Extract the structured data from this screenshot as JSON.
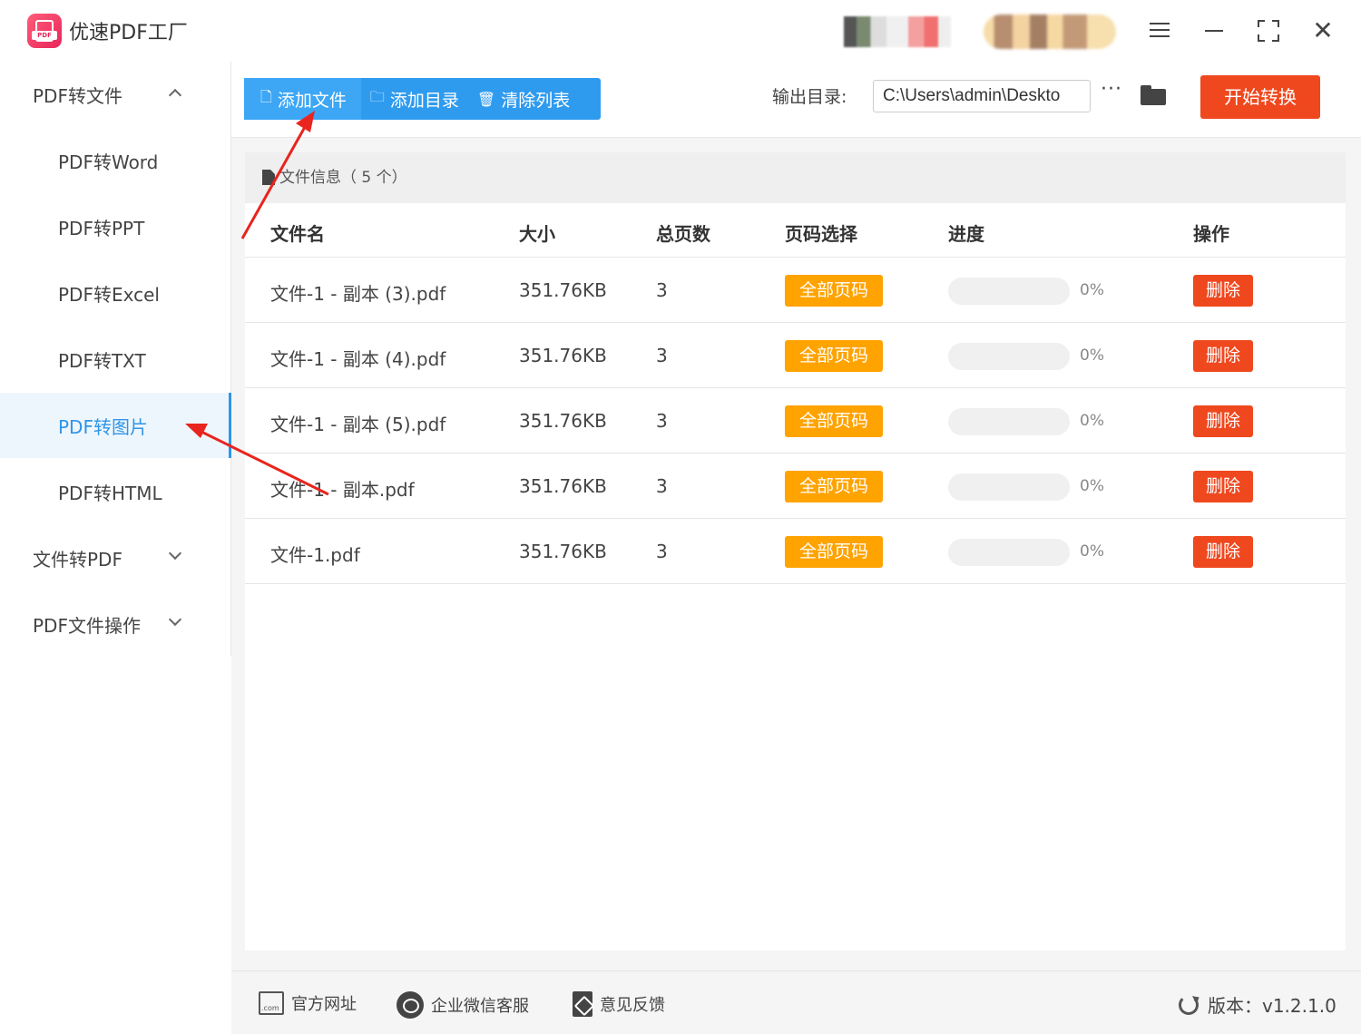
{
  "app": {
    "title": "优速PDF工厂",
    "logo_text": "PDF"
  },
  "sidebar": {
    "groups": [
      {
        "label": "PDF转文件",
        "expanded": true
      },
      {
        "label": "文件转PDF",
        "expanded": false
      },
      {
        "label": "PDF文件操作",
        "expanded": false
      }
    ],
    "items": [
      {
        "label": "PDF转Word"
      },
      {
        "label": "PDF转PPT"
      },
      {
        "label": "PDF转Excel"
      },
      {
        "label": "PDF转TXT"
      },
      {
        "label": "PDF转图片",
        "active": true
      },
      {
        "label": "PDF转HTML"
      }
    ]
  },
  "toolbar": {
    "add_file": "添加文件",
    "add_folder": "添加目录",
    "clear_list": "清除列表",
    "output_label": "输出目录:",
    "output_path": "C:\\Users\\admin\\Deskto",
    "more": "···",
    "start": "开始转换"
  },
  "panel": {
    "header": "文件信息（ 5 个）",
    "columns": {
      "name": "文件名",
      "size": "大小",
      "pages": "总页数",
      "page_select": "页码选择",
      "progress": "进度",
      "action": "操作"
    },
    "rows": [
      {
        "name": "文件-1 - 副本 (3).pdf",
        "size": "351.76KB",
        "pages": "3",
        "page_select": "全部页码",
        "progress_pct": 0,
        "progress": "0%",
        "action": "删除"
      },
      {
        "name": "文件-1 - 副本 (4).pdf",
        "size": "351.76KB",
        "pages": "3",
        "page_select": "全部页码",
        "progress_pct": 0,
        "progress": "0%",
        "action": "删除"
      },
      {
        "name": "文件-1 - 副本 (5).pdf",
        "size": "351.76KB",
        "pages": "3",
        "page_select": "全部页码",
        "progress_pct": 0,
        "progress": "0%",
        "action": "删除"
      },
      {
        "name": "文件-1 - 副本.pdf",
        "size": "351.76KB",
        "pages": "3",
        "page_select": "全部页码",
        "progress_pct": 0,
        "progress": "0%",
        "action": "删除"
      },
      {
        "name": "文件-1.pdf",
        "size": "351.76KB",
        "pages": "3",
        "page_select": "全部页码",
        "progress_pct": 0,
        "progress": "0%",
        "action": "删除"
      }
    ]
  },
  "footer": {
    "website": "官方网址",
    "wechat": "企业微信客服",
    "feedback": "意见反馈",
    "version": "版本：v1.2.1.0"
  },
  "colors": {
    "accent": "#2f9bef",
    "start": "#f0481e",
    "page_select": "#ffa300",
    "delete": "#f0481e",
    "annotation": "#e8251e"
  },
  "icons": [
    "menu-icon",
    "minimize-icon",
    "maximize-icon",
    "close-icon",
    "chevron-up-icon",
    "chevron-down-icon",
    "file-icon",
    "folder-outline-icon",
    "trash-icon",
    "folder-icon",
    "document-icon",
    "website-icon",
    "wechat-icon",
    "feedback-icon",
    "refresh-icon"
  ]
}
